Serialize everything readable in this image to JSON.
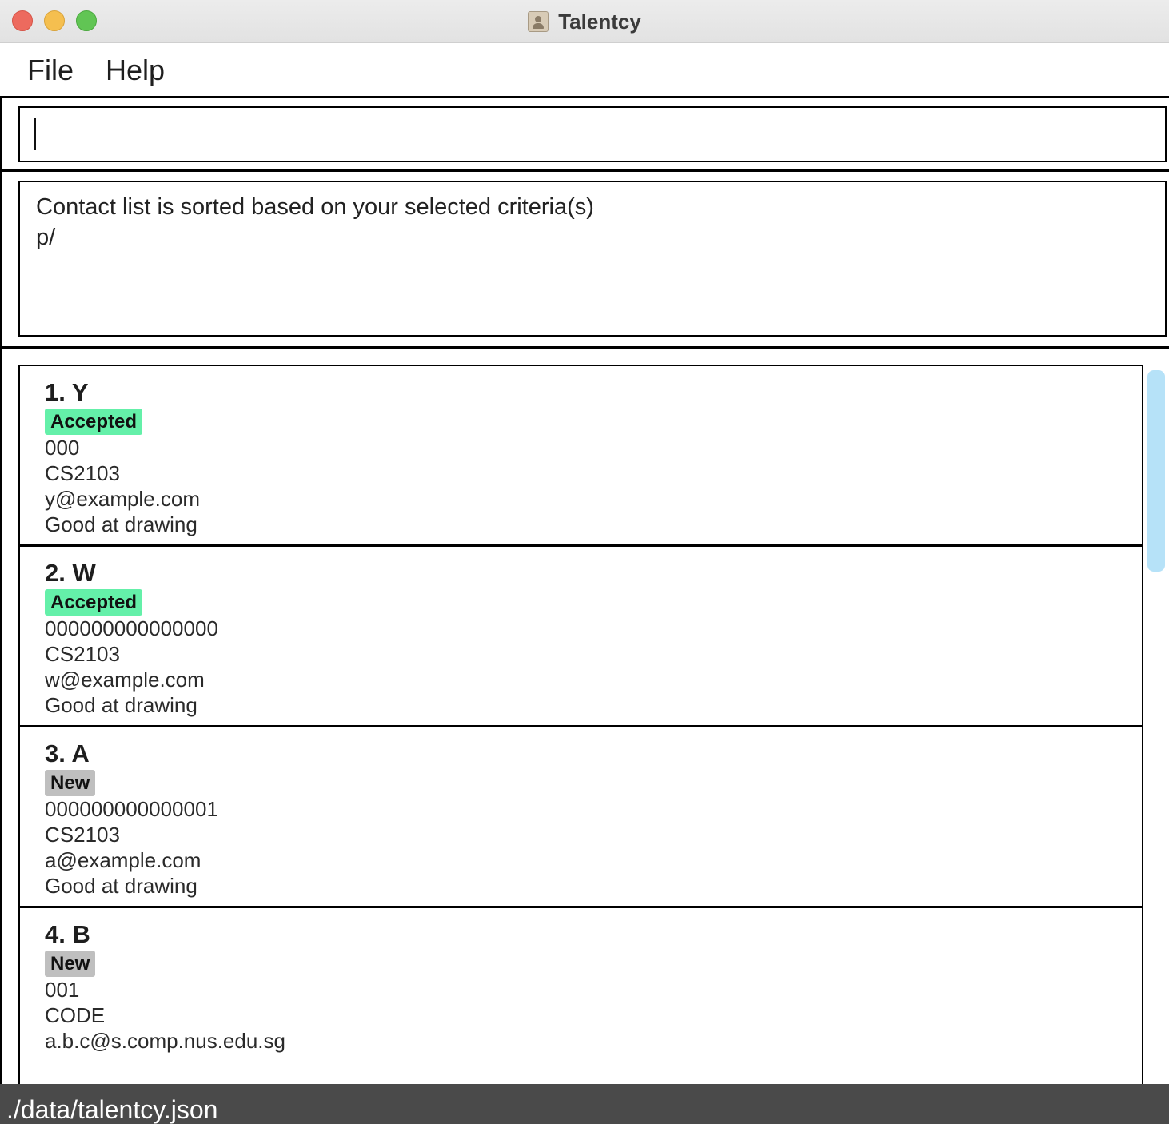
{
  "window": {
    "title": "Talentcy"
  },
  "menu": {
    "items": [
      "File",
      "Help"
    ]
  },
  "command": {
    "value": "",
    "placeholder": ""
  },
  "result": {
    "lines": [
      "Contact list is sorted based on your selected criteria(s)",
      "p/"
    ]
  },
  "colors": {
    "accepted_tag": "#64f0a9",
    "new_tag": "#bfbfbf",
    "status_bar": "#4a4a4a",
    "scrollbar": "#b6e2f8"
  },
  "persons": [
    {
      "name": "1. Y",
      "status": "Accepted",
      "status_color": "#64f0a9",
      "phone": "000",
      "course": "CS2103",
      "email": "y@example.com",
      "remark": "Good at drawing"
    },
    {
      "name": "2. W",
      "status": "Accepted",
      "status_color": "#64f0a9",
      "phone": "000000000000000",
      "course": "CS2103",
      "email": "w@example.com",
      "remark": "Good at drawing"
    },
    {
      "name": "3. A",
      "status": "New",
      "status_color": "#bfbfbf",
      "phone": "000000000000001",
      "course": "CS2103",
      "email": "a@example.com",
      "remark": "Good at drawing"
    },
    {
      "name": "4. B",
      "status": "New",
      "status_color": "#bfbfbf",
      "phone": "001",
      "course": "CODE",
      "email": "a.b.c@s.comp.nus.edu.sg",
      "remark": ""
    }
  ],
  "status_bar": {
    "path": "./data/talentcy.json"
  }
}
